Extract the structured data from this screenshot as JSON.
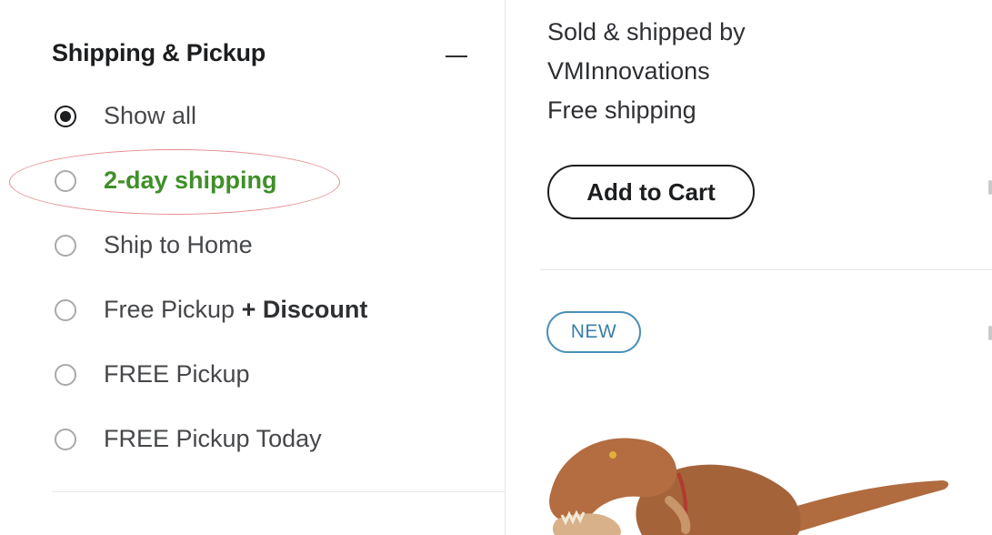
{
  "filter": {
    "title": "Shipping & Pickup",
    "options": [
      {
        "label": "Show all",
        "checked": true
      },
      {
        "label": "2-day shipping",
        "checked": false,
        "highlighted": true
      },
      {
        "label": "Ship to Home",
        "checked": false
      },
      {
        "label": "Free Pickup",
        "suffix": "+ Discount",
        "checked": false
      },
      {
        "label": "FREE Pickup",
        "checked": false
      },
      {
        "label": "FREE Pickup Today",
        "checked": false
      }
    ]
  },
  "product": {
    "sold_by_line1": "Sold & shipped by",
    "seller_name": "VMInnovations",
    "shipping": "Free shipping",
    "add_to_cart_label": "Add to Cart",
    "badge": "NEW",
    "image_icon": "dinosaur-toy-image"
  },
  "colors": {
    "accent_green": "#3f8f28",
    "badge_blue": "#4a90b8",
    "highlight_red": "#e58a8f",
    "text_dark": "#1c1d1f"
  }
}
